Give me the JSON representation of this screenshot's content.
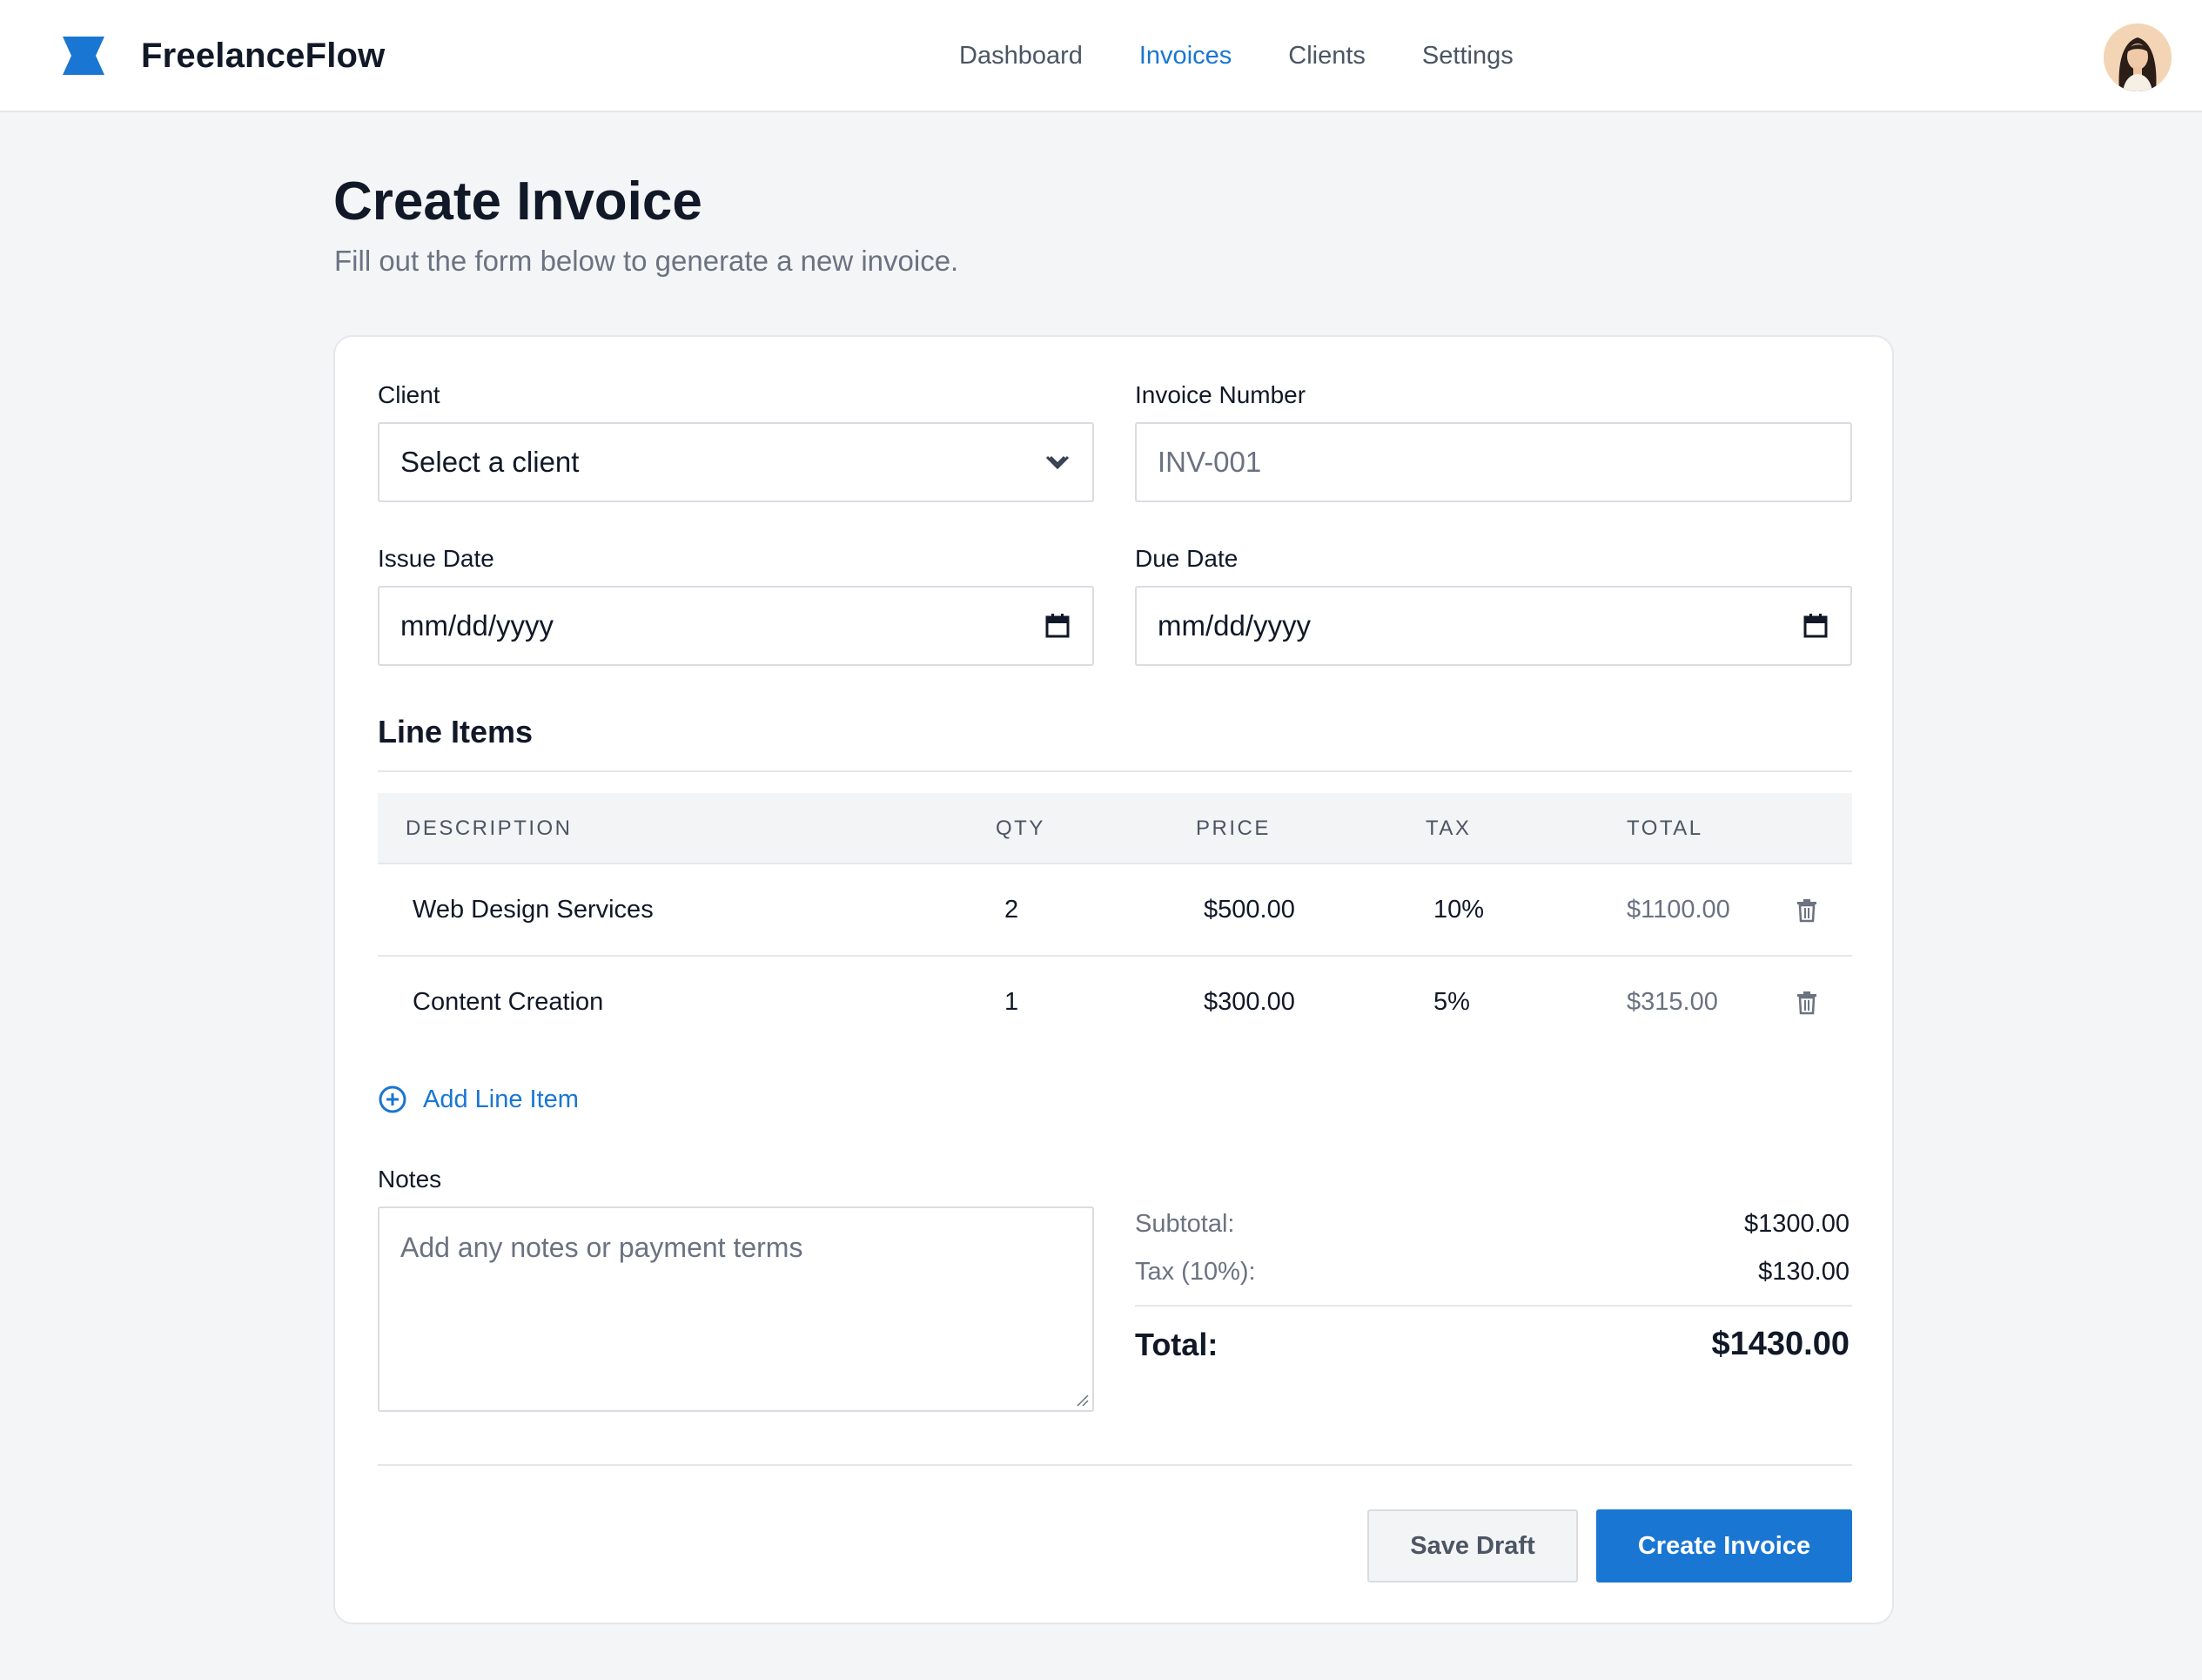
{
  "app": {
    "name": "FreelanceFlow",
    "brand_color": "#1976d2"
  },
  "nav": {
    "items": [
      {
        "label": "Dashboard",
        "active": false
      },
      {
        "label": "Invoices",
        "active": true
      },
      {
        "label": "Clients",
        "active": false
      },
      {
        "label": "Settings",
        "active": false
      }
    ]
  },
  "page": {
    "title": "Create Invoice",
    "subtitle": "Fill out the form below to generate a new invoice."
  },
  "form": {
    "client": {
      "label": "Client",
      "value": "Select a client",
      "icon": "chevron-down-icon"
    },
    "invoice_number": {
      "label": "Invoice Number",
      "placeholder": "INV-001"
    },
    "issue_date": {
      "label": "Issue Date",
      "value": "mm/dd/yyyy",
      "icon": "calendar-icon"
    },
    "due_date": {
      "label": "Due Date",
      "value": "mm/dd/yyyy",
      "icon": "calendar-icon"
    }
  },
  "line_items": {
    "title": "Line Items",
    "columns": [
      "DESCRIPTION",
      "QTY",
      "PRICE",
      "TAX",
      "TOTAL"
    ],
    "rows": [
      {
        "description": "Web Design Services",
        "qty": "2",
        "price": "$500.00",
        "tax": "10%",
        "total": "$1100.00"
      },
      {
        "description": "Content Creation",
        "qty": "1",
        "price": "$300.00",
        "tax": "5%",
        "total": "$315.00"
      }
    ],
    "add_label": "Add Line Item"
  },
  "notes": {
    "label": "Notes",
    "placeholder": "Add any notes or payment terms"
  },
  "summary": {
    "subtotal_label": "Subtotal:",
    "subtotal_value": "$1300.00",
    "tax_label": "Tax (10%):",
    "tax_value": "$130.00",
    "total_label": "Total:",
    "total_value": "$1430.00"
  },
  "actions": {
    "save_draft": "Save Draft",
    "create": "Create Invoice"
  }
}
